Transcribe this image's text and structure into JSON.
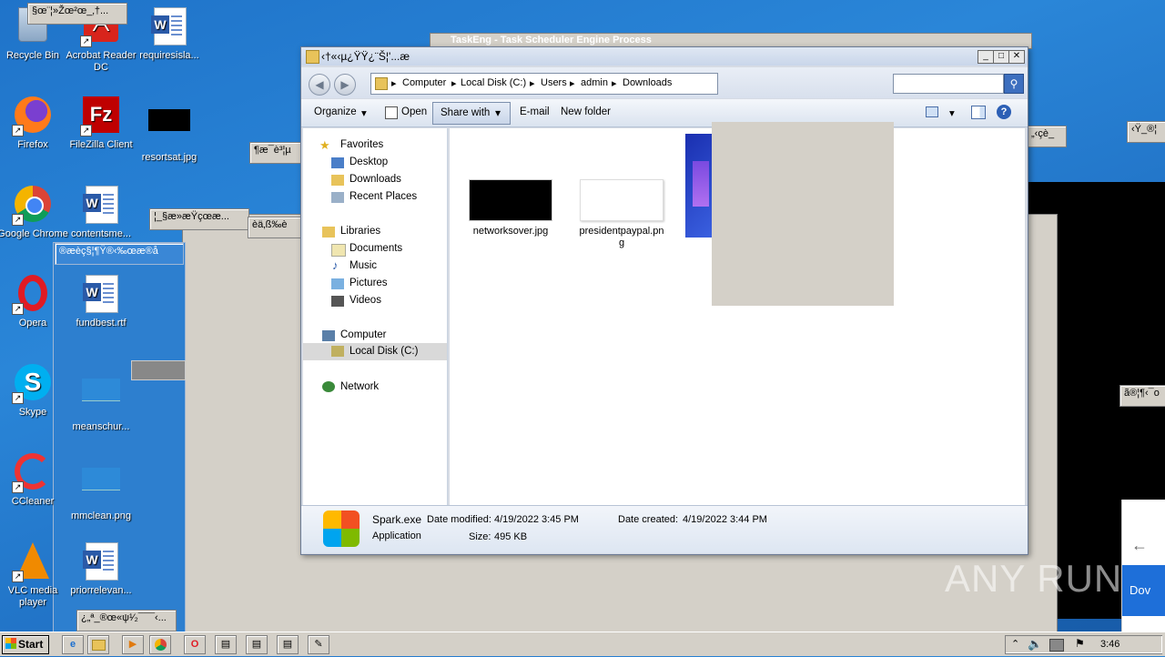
{
  "desktop": {
    "icons": [
      {
        "label": "Recycle Bin"
      },
      {
        "label": "Acrobat Reader DC"
      },
      {
        "label": "requiresisla..."
      },
      {
        "label": "Firefox"
      },
      {
        "label": "FileZilla Client"
      },
      {
        "label": "resortsat.jpg"
      },
      {
        "label": "Google Chrome"
      },
      {
        "label": "contentsme..."
      },
      {
        "label": "Opera"
      },
      {
        "label": "fundbest.rtf"
      },
      {
        "label": "Skype"
      },
      {
        "label": "meanschur..."
      },
      {
        "label": "CCleaner"
      },
      {
        "label": "mmclean.png"
      },
      {
        "label": "VLC media player"
      },
      {
        "label": "priorrelevan..."
      }
    ],
    "garbled_titles": [
      "§œ¨¦»Žœ²œ_‚†...",
      "¶æ¯è³¦µ",
      "¦_§æ»æŸçœæ...",
      "®æèç§¦¶Ÿ®‹‰œæ®å",
      "èä‚ß‰è",
      "¿„ª_®œ«ψ¹⁄₂¯¯¯‹...",
      "‹Ÿ_®¦",
      "„‹çè_",
      "ã®¦¶‹¯o"
    ],
    "taskeng_title": "TaskEng - Task Scheduler Engine Process",
    "watermark": "ANY RUN",
    "partial_button": "Dov"
  },
  "explorer": {
    "title": "‹†«‹µ¿ŸŸ¿¨Š¦'...æ",
    "breadcrumb": [
      "Computer",
      "Local Disk (C:)",
      "Users",
      "admin",
      "Downloads"
    ],
    "toolbar": {
      "organize": "Organize",
      "open": "Open",
      "share_with": "Share with",
      "email": "E-mail",
      "new_folder": "New folder"
    },
    "nav": {
      "favorites": "Favorites",
      "desktop": "Desktop",
      "downloads": "Downloads",
      "recent": "Recent Places",
      "libraries": "Libraries",
      "documents": "Documents",
      "music": "Music",
      "pictures": "Pictures",
      "videos": "Videos",
      "computer": "Computer",
      "localdisk": "Local Disk (C:)",
      "network": "Network"
    },
    "files": [
      {
        "name": "networksover.jpg"
      },
      {
        "name": "presidentpaypal.png"
      }
    ],
    "details": {
      "name": "Spark.exe",
      "type": "Application",
      "modified_label": "Date modified:",
      "modified": "4/19/2022 3:45 PM",
      "created_label": "Date created:",
      "created": "4/19/2022 3:44 PM",
      "size_label": "Size:",
      "size": "495 KB"
    }
  },
  "taskbar": {
    "start": "Start",
    "clock": "3:46"
  }
}
